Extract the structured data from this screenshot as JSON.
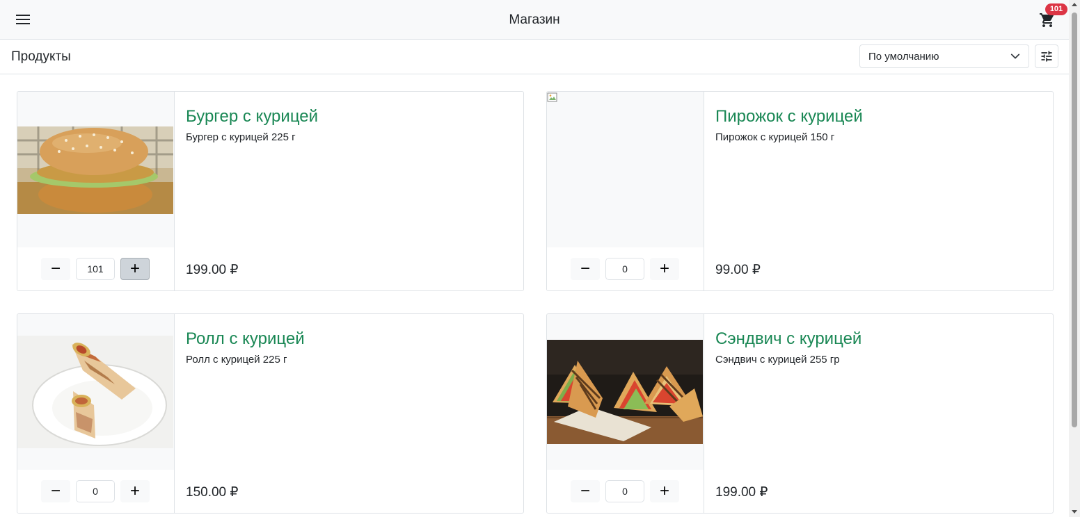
{
  "header": {
    "title": "Магазин",
    "menu_icon": "hamburger-menu-icon",
    "cart_icon": "shopping-cart-icon",
    "cart_count": "101"
  },
  "toolbar": {
    "title": "Продукты",
    "sort_selected": "По умолчанию",
    "filter_icon": "tune-sliders-icon"
  },
  "colors": {
    "accent": "#198754",
    "badge": "#dc3545",
    "header_bg": "#f8f9fa",
    "border": "#dee2e6"
  },
  "products": [
    {
      "name": "Бургер с курицей",
      "description": "Бургер с курицей 225 г",
      "price": "199.00 ₽",
      "quantity": "101",
      "image": "chicken-burger-photo"
    },
    {
      "name": "Пирожок с курицей",
      "description": "Пирожок с курицей 150 г",
      "price": "99.00 ₽",
      "quantity": "0",
      "image": "broken-image-icon"
    },
    {
      "name": "Ролл с курицей",
      "description": "Ролл с курицей 225 г",
      "price": "150.00 ₽",
      "quantity": "0",
      "image": "chicken-roll-photo"
    },
    {
      "name": "Сэндвич с курицей",
      "description": "Сэндвич с курицей 255 гр",
      "price": "199.00 ₽",
      "quantity": "0",
      "image": "chicken-sandwich-photo"
    }
  ],
  "quantity_controls": {
    "minus": "−",
    "plus": "+"
  }
}
